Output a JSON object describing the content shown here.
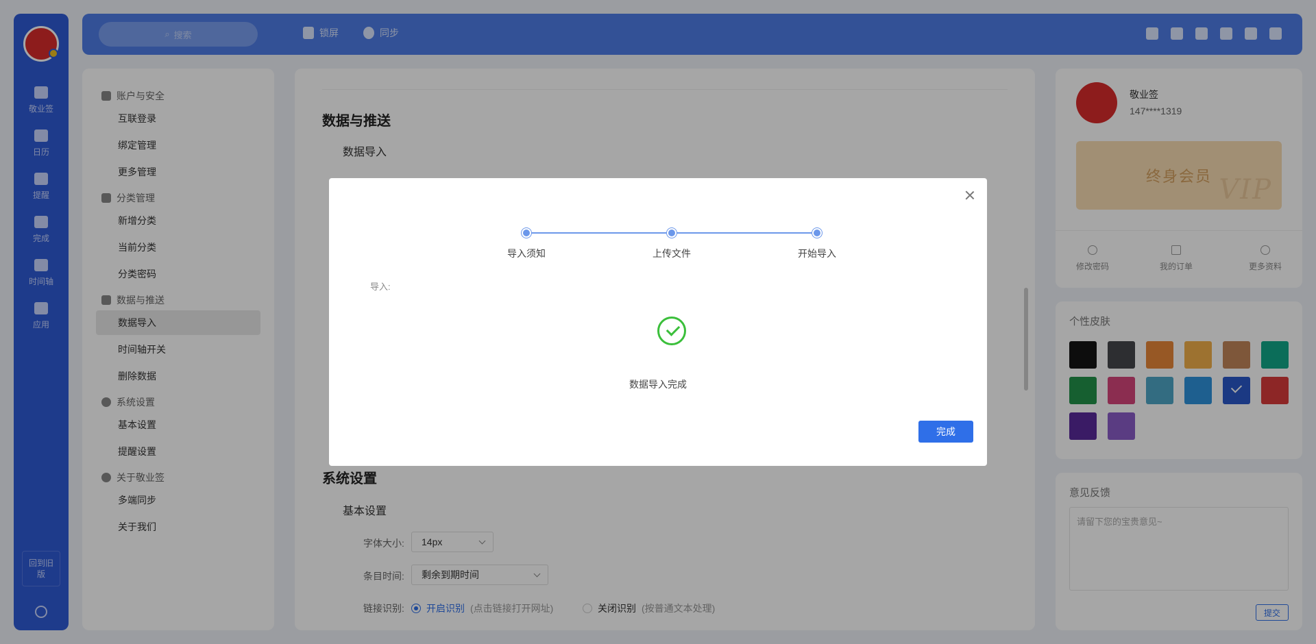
{
  "topbar": {
    "search_placeholder": "搜索",
    "lock_label": "锁屏",
    "sync_label": "同步",
    "platform_icons": [
      "desktop-icon",
      "tablet-icon",
      "apple-icon",
      "android-icon",
      "browser-icon",
      "windows-icon"
    ]
  },
  "rail": {
    "items": [
      {
        "label": "敬业签",
        "icon": "note-icon"
      },
      {
        "label": "日历",
        "icon": "calendar-icon"
      },
      {
        "label": "提醒",
        "icon": "bell-icon"
      },
      {
        "label": "完成",
        "icon": "done-icon"
      },
      {
        "label": "时间轴",
        "icon": "timeline-icon"
      },
      {
        "label": "应用",
        "icon": "app-icon"
      }
    ],
    "back_label": "回到旧版"
  },
  "menu": {
    "groups": [
      {
        "title": "账户与安全",
        "items": [
          "互联登录",
          "绑定管理",
          "更多管理"
        ]
      },
      {
        "title": "分类管理",
        "items": [
          "新增分类",
          "当前分类",
          "分类密码"
        ]
      },
      {
        "title": "数据与推送",
        "items": [
          "数据导入",
          "时间轴开关",
          "删除数据"
        ]
      },
      {
        "title": "系统设置",
        "items": [
          "基本设置",
          "提醒设置"
        ]
      },
      {
        "title": "关于敬业签",
        "items": [
          "多端同步",
          "关于我们"
        ]
      }
    ],
    "active_item": "数据导入"
  },
  "main": {
    "section_data_title": "数据与推送",
    "sub_data_import": "数据导入",
    "section_system_title": "系统设置",
    "sub_basic": "基本设置",
    "font_size_label": "字体大小:",
    "font_size_value": "14px",
    "item_time_label": "条目时间:",
    "item_time_value": "剩余到期时间",
    "link_label": "链接识别:",
    "link_on": "开启识别",
    "link_on_hint": "(点击链接打开网址)",
    "link_off": "关闭识别",
    "link_off_hint": "(按普通文本处理)"
  },
  "profile": {
    "name": "敬业签",
    "phone": "147****1319",
    "vip_label": "终身会员",
    "vip_mark": "VIP",
    "actions": [
      "修改密码",
      "我的订单",
      "更多资料"
    ]
  },
  "skins": {
    "title": "个性皮肤",
    "colors": [
      "#151515",
      "#45474c",
      "#e8883a",
      "#f2b04a",
      "#c2865a",
      "#12a889",
      "#23934a",
      "#d6467c",
      "#4fa6c6",
      "#2f93dc",
      "#2a58c9",
      "#d93b3b",
      "#5a2a9c",
      "#8a5cc8"
    ],
    "selected_index": 10
  },
  "feedback": {
    "title": "意见反馈",
    "placeholder": "请留下您的宝贵意见~",
    "submit_label": "提交"
  },
  "modal": {
    "steps": [
      "导入须知",
      "上传文件",
      "开始导入"
    ],
    "import_label": "导入:",
    "success_text": "数据导入完成",
    "done_label": "完成"
  }
}
